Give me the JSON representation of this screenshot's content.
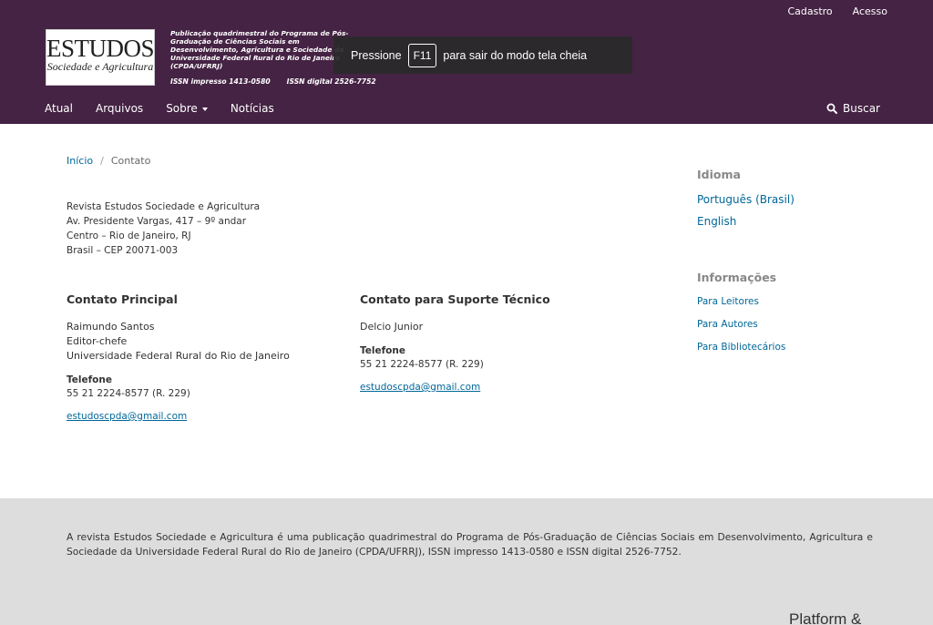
{
  "user_nav": {
    "register": "Cadastro",
    "login": "Acesso"
  },
  "logo": {
    "line1": "ESTUDOS",
    "line2": "Sociedade e Agricultura"
  },
  "tagline": "Publicação quadrimestral do Programa de Pós-Graduação de Ciências Sociais em Desenvolvimento, Agricultura e Sociedade da Universidade Federal Rural do Rio de Janeiro (CPDA/UFRRJ)",
  "issn": {
    "print": "ISSN impresso 1413-0580",
    "digital": "ISSN digital 2526-7752"
  },
  "fullscreen_notice": {
    "before": "Pressione",
    "key": "F11",
    "after": "para sair do modo tela cheia"
  },
  "main_nav": {
    "current": "Atual",
    "archives": "Arquivos",
    "about": "Sobre",
    "news": "Notícias",
    "search": "Buscar"
  },
  "breadcrumb": {
    "home": "Início",
    "separator": "/",
    "current": "Contato"
  },
  "address": [
    "Revista Estudos Sociedade e Agricultura",
    "Av. Presidente Vargas, 417 – 9º andar",
    "Centro – Rio de Janeiro, RJ",
    "Brasil – CEP 20071-003"
  ],
  "principal_contact": {
    "heading": "Contato Principal",
    "name": "Raimundo Santos",
    "title": "Editor-chefe",
    "affiliation": "Universidade Federal Rural do Rio de Janeiro",
    "phone_label": "Telefone",
    "phone": "55 21 2224-8577 (R. 229)",
    "email": "estudoscpda@gmail.com"
  },
  "support_contact": {
    "heading": "Contato para Suporte Técnico",
    "name": "Delcio Junior",
    "phone_label": "Telefone",
    "phone": "55 21 2224-8577 (R. 229)",
    "email": "estudoscpda@gmail.com"
  },
  "sidebar": {
    "language_heading": "Idioma",
    "languages": [
      "Português (Brasil)",
      "English"
    ],
    "info_heading": "Informações",
    "info_links": [
      "Para Leitores",
      "Para Autores",
      "Para Bibliotecários"
    ]
  },
  "footer": {
    "text": "A revista Estudos Sociedade e Agricultura é uma publicação quadrimestral do Programa de Pós-Graduação de Ciências Sociais em Desenvolvimento, Agricultura e Sociedade da Universidade Federal Rural do Rio de Janeiro (CPDA/UFRRJ), ISSN impresso 1413-0580 e ISSN digital 2526-7752.",
    "brand_partial": "Platform &"
  },
  "colors": {
    "header_bg": "#452344",
    "link": "#006798",
    "footer_bg": "#dddddd"
  }
}
